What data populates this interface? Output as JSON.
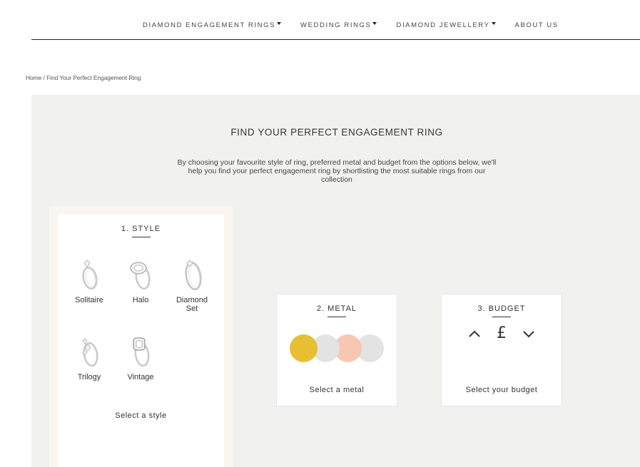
{
  "nav": {
    "items": [
      {
        "label": "DIAMOND ENGAGEMENT RINGS",
        "dropdown": true
      },
      {
        "label": "WEDDING RINGS",
        "dropdown": true
      },
      {
        "label": "DIAMOND JEWELLERY",
        "dropdown": true
      },
      {
        "label": "ABOUT US",
        "dropdown": false
      }
    ]
  },
  "breadcrumb": {
    "home": "Home",
    "separator": " / ",
    "current": "Find Your Perfect Engagement Ring"
  },
  "finder": {
    "title": "FIND YOUR PERFECT ENGAGEMENT RING",
    "intro": "By choosing your favourite style of ring, preferred metal and budget from the options below, we'll help you find your perfect engagement ring by shortlisting the most suitable rings from our collection"
  },
  "style": {
    "heading": "1. STYLE",
    "options": [
      {
        "label": "Solitaire",
        "icon": "solitaire-ring-icon"
      },
      {
        "label": "Halo",
        "icon": "halo-ring-icon"
      },
      {
        "label": "Diamond Set",
        "icon": "diamond-set-ring-icon"
      },
      {
        "label": "Trilogy",
        "icon": "trilogy-ring-icon"
      },
      {
        "label": "Vintage",
        "icon": "vintage-ring-icon"
      }
    ],
    "prompt": "Select a style"
  },
  "metal": {
    "heading": "2. METAL",
    "swatches": [
      {
        "name": "yellow-gold",
        "color": "#e8bf32"
      },
      {
        "name": "white-gold",
        "color": "#e2e3e2"
      },
      {
        "name": "rose-gold",
        "color": "#f7c7b3"
      },
      {
        "name": "platinum",
        "color": "#e2e3e2"
      }
    ],
    "prompt": "Select a metal"
  },
  "budget": {
    "heading": "3. BUDGET",
    "currency": "£",
    "prompt": "Select your budget"
  },
  "colors": {
    "panel": "#f1f2f0",
    "style_card_border": "#f8f6ef",
    "text": "#333333"
  }
}
